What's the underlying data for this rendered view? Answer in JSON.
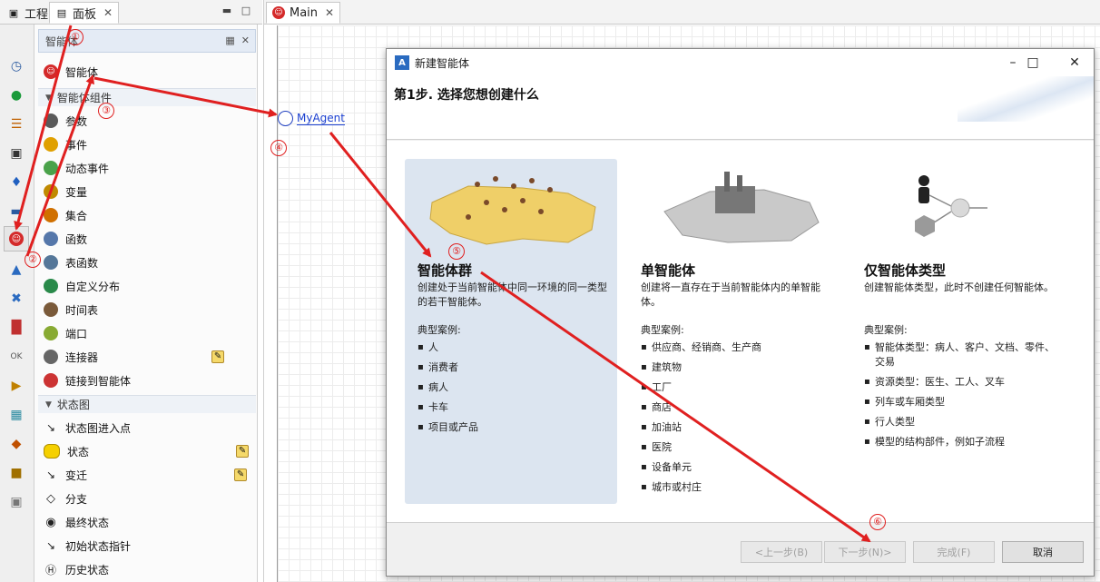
{
  "left_tabs": {
    "project": "工程",
    "palette": "面板"
  },
  "palette": {
    "header": "智能体",
    "top_item": "智能体",
    "section_components": "智能体组件",
    "components": [
      {
        "label": "参数",
        "icon": "parameter-icon",
        "color": "#5a5a5a"
      },
      {
        "label": "事件",
        "icon": "event-lightning-icon",
        "color": "#e0a000"
      },
      {
        "label": "动态事件",
        "icon": "dynamic-event-icon",
        "color": "#4aa24a"
      },
      {
        "label": "变量",
        "icon": "variable-icon",
        "color": "#c08a00"
      },
      {
        "label": "集合",
        "icon": "collection-icon",
        "color": "#d07000"
      },
      {
        "label": "函数",
        "icon": "function-icon",
        "color": "#5577aa"
      },
      {
        "label": "表函数",
        "icon": "table-function-icon",
        "color": "#557799"
      },
      {
        "label": "自定义分布",
        "icon": "custom-distribution-icon",
        "color": "#2a8a4a"
      },
      {
        "label": "时间表",
        "icon": "schedule-icon",
        "color": "#7a5a3a"
      },
      {
        "label": "端口",
        "icon": "port-icon",
        "color": "#88aa33"
      },
      {
        "label": "连接器",
        "icon": "connector-icon",
        "color": "#666666"
      },
      {
        "label": "链接到智能体",
        "icon": "link-to-agents-icon",
        "color": "#cc3333"
      }
    ],
    "section_statechart": "状态图",
    "statechart": [
      {
        "label": "状态图进入点",
        "icon": "statechart-entry-icon",
        "color": "#222222"
      },
      {
        "label": "状态",
        "icon": "state-icon",
        "color": "#f5d000"
      },
      {
        "label": "变迁",
        "icon": "transition-icon",
        "color": "#222222"
      },
      {
        "label": "分支",
        "icon": "branch-icon",
        "color": "#222222"
      },
      {
        "label": "最终状态",
        "icon": "final-state-icon",
        "color": "#222222"
      },
      {
        "label": "初始状态指针",
        "icon": "initial-state-pointer-icon",
        "color": "#222222"
      },
      {
        "label": "历史状态",
        "icon": "history-state-icon",
        "color": "#222222"
      }
    ]
  },
  "editor": {
    "tab": "Main",
    "agent_label": "MyAgent"
  },
  "dialog": {
    "title": "新建智能体",
    "heading": "第1步. 选择您想创建什么",
    "options": [
      {
        "title": "智能体群",
        "desc": "创建处于当前智能体中同一环境的同一类型的若干智能体。",
        "examples_heading": "典型案例:",
        "examples": [
          "人",
          "消费者",
          "病人",
          "卡车",
          "项目或产品"
        ]
      },
      {
        "title": "单智能体",
        "desc": "创建将一直存在于当前智能体内的单智能体。",
        "examples_heading": "典型案例:",
        "examples": [
          "供应商、经销商、生产商",
          "建筑物",
          "工厂",
          "商店",
          "加油站",
          "医院",
          "设备单元",
          "城市或村庄"
        ]
      },
      {
        "title": "仅智能体类型",
        "desc": "创建智能体类型，此时不创建任何智能体。",
        "examples_heading": "典型案例:",
        "examples": [
          "智能体类型：病人、客户、文档、零件、交易",
          "资源类型：医生、工人、叉车",
          "列车或车厢类型",
          "行人类型",
          "模型的结构部件，例如子流程"
        ]
      }
    ],
    "buttons": {
      "back": "<上一步(B)",
      "next": "下一步(N)>",
      "finish": "完成(F)",
      "cancel": "取消"
    }
  },
  "annotations": [
    "①",
    "②",
    "③",
    "④",
    "⑤",
    "⑥"
  ],
  "colors": {
    "arrow": "#e02020",
    "selection": "#dce5f0",
    "agent_link": "#1a3fd0"
  }
}
